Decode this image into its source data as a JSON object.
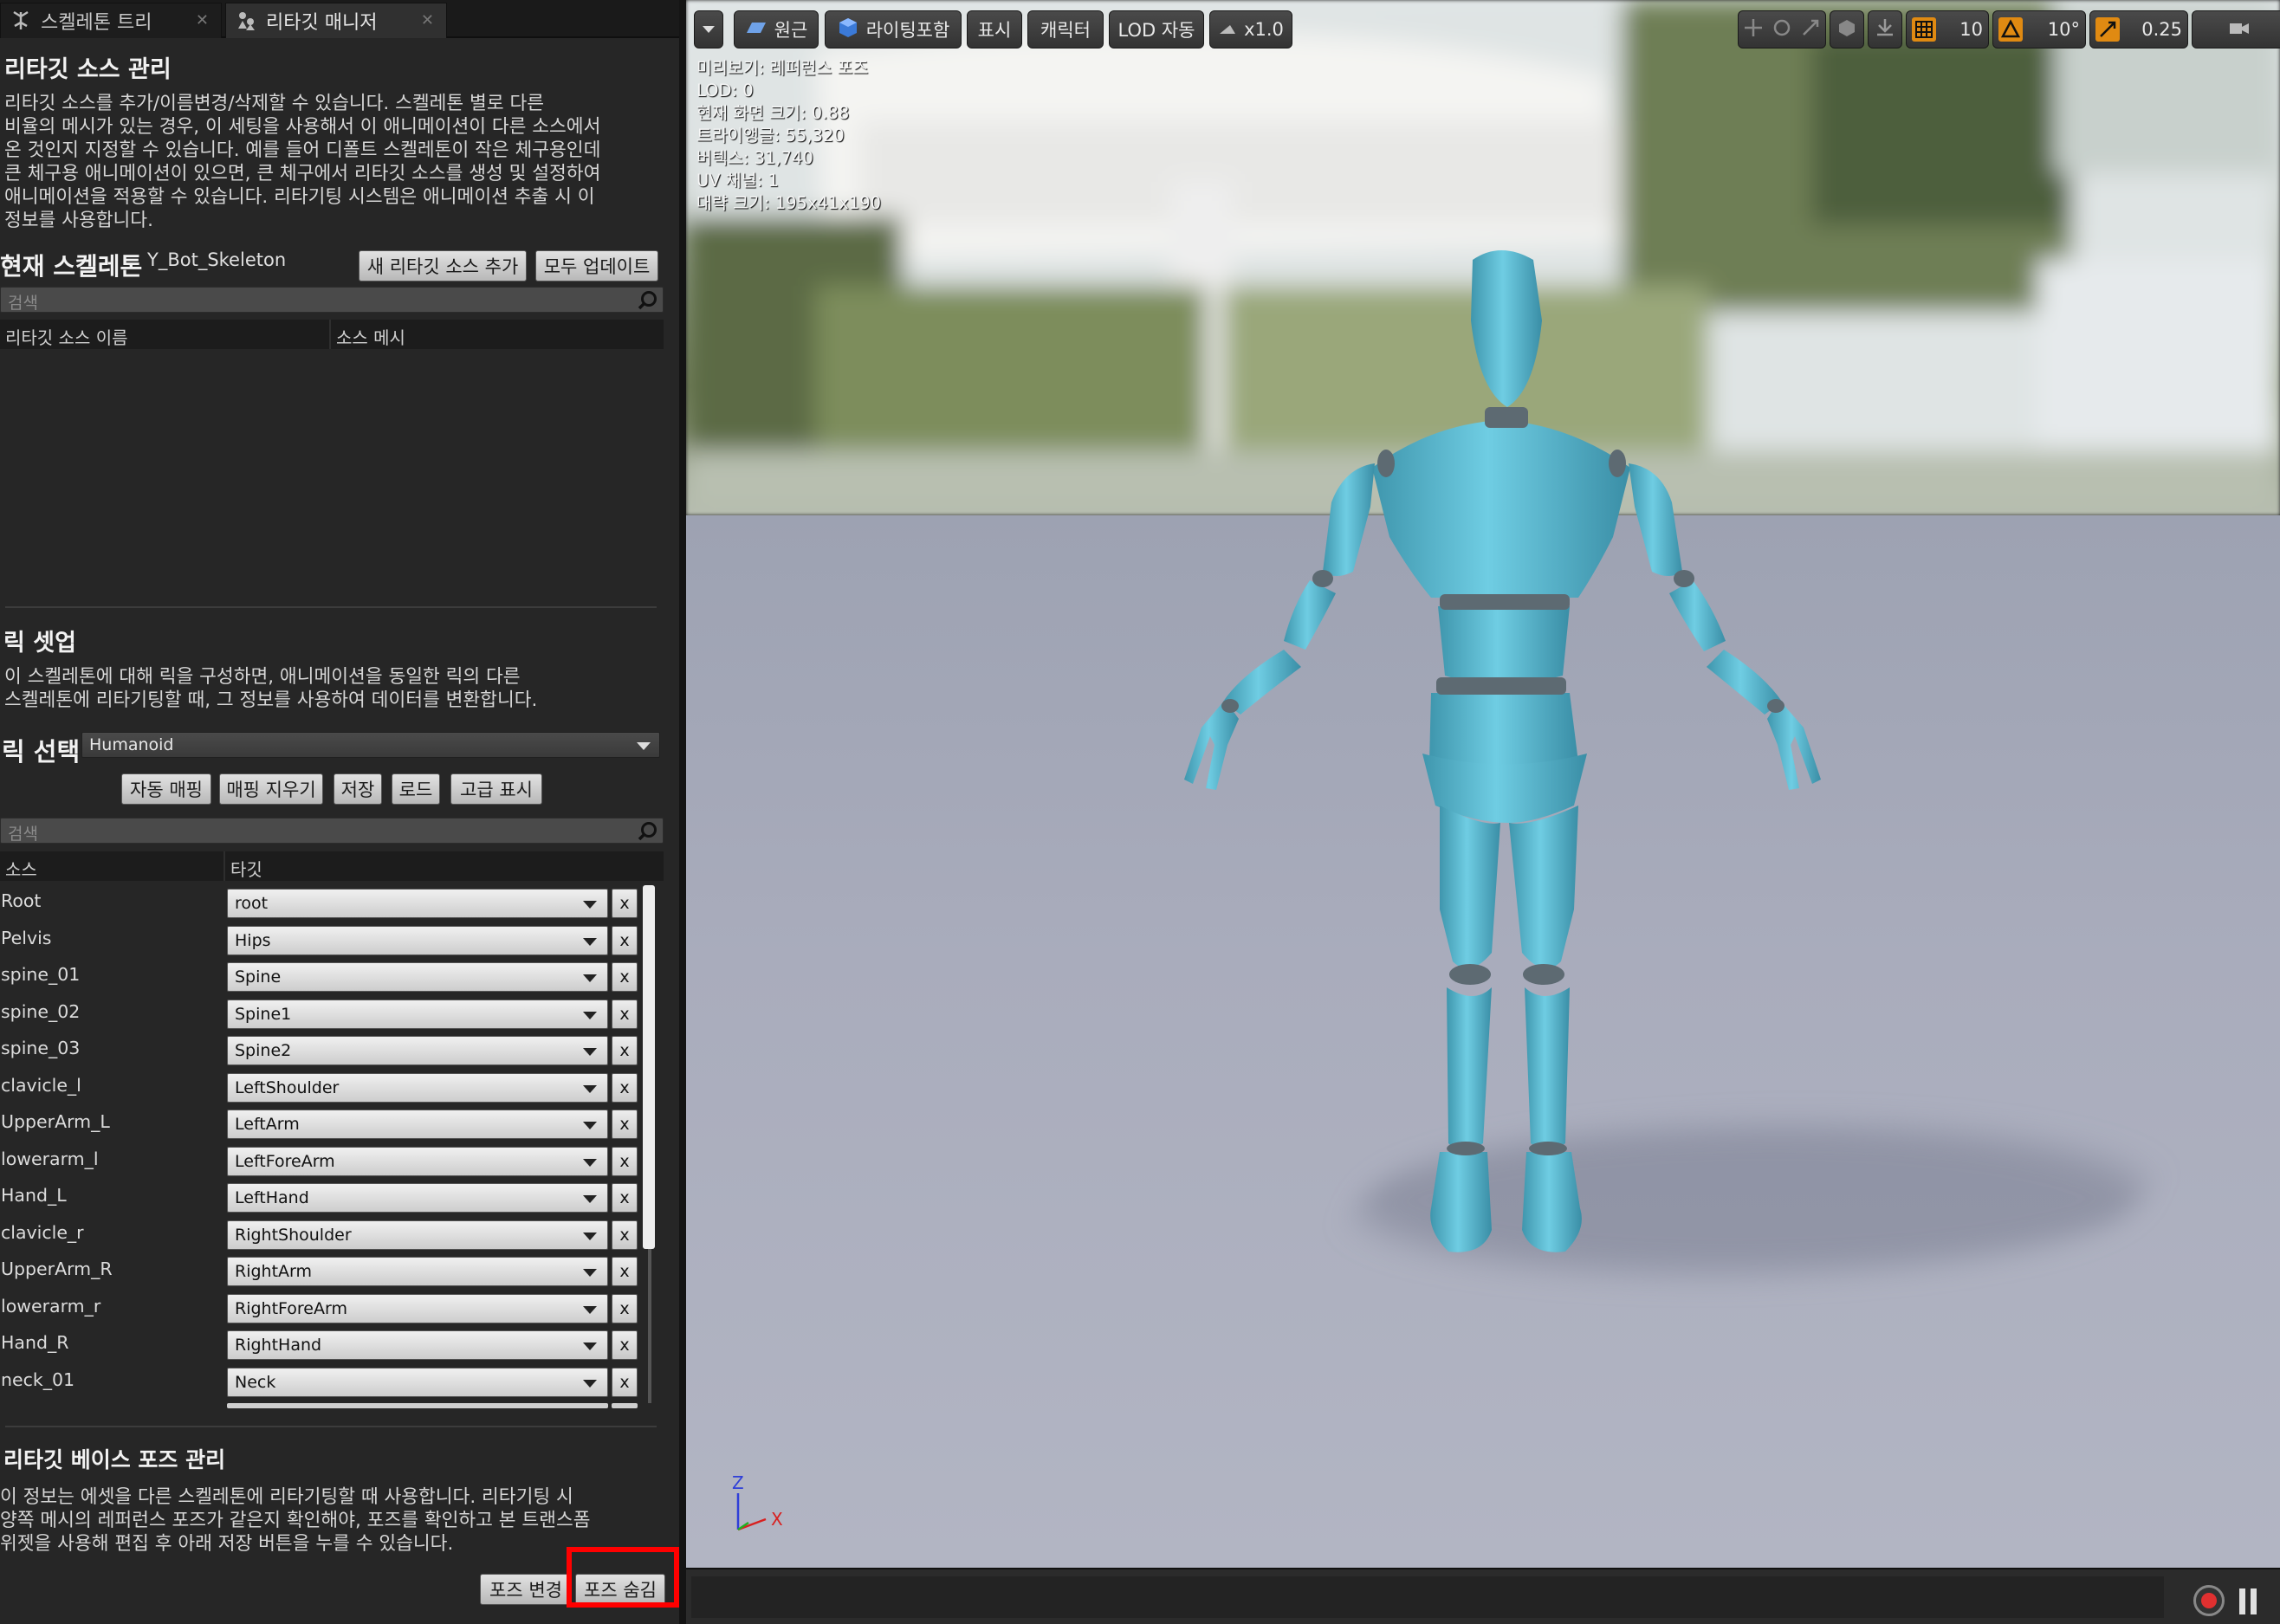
{
  "tabs": [
    {
      "label": "스켈레톤 트리",
      "icon": "skeleton-tree-icon"
    },
    {
      "label": "리타깃 매니저",
      "icon": "retarget-manager-icon"
    }
  ],
  "source": {
    "title": "리타깃 소스 관리",
    "description": [
      "리타깃 소스를 추가/이름변경/삭제할 수 있습니다. 스켈레톤 별로 다른",
      "비율의 메시가 있는 경우, 이 세팅을 사용해서 이 애니메이션이 다른 소스에서",
      "온 것인지 지정할 수 있습니다. 예를 들어 디폴트 스켈레톤이 작은 체구용인데",
      "큰 체구용 애니메이션이 있으면, 큰 체구에서 리타깃 소스를 생성 및 설정하여",
      "애니메이션을 적용할 수 있습니다. 리타기팅 시스템은 애니메이션 추출 시 이",
      "정보를 사용합니다."
    ],
    "current_skeleton_label": "현재 스켈레톤",
    "current_skeleton_value": "Y_Bot_Skeleton",
    "add_button": "새 리타깃 소스 추가",
    "update_all_button": "모두 업데이트",
    "search_placeholder": "검색",
    "col_name": "리타깃 소스 이름",
    "col_mesh": "소스 메시"
  },
  "rig": {
    "title": "릭 셋업",
    "description": [
      "이 스켈레톤에 대해 릭을 구성하면, 애니메이션을 동일한 릭의 다른",
      "스켈레톤에 리타기팅할 때, 그 정보를 사용하여 데이터를 변환합니다."
    ],
    "select_label": "릭 선택",
    "select_value": "Humanoid",
    "buttons": {
      "auto_map": "자동 매핑",
      "clear_map": "매핑 지우기",
      "save": "저장",
      "load": "로드",
      "advanced": "고급 표시"
    },
    "search_placeholder": "검색",
    "col_source": "소스",
    "col_target": "타깃",
    "mappings": [
      {
        "source": "Root",
        "target": "root"
      },
      {
        "source": "Pelvis",
        "target": "Hips"
      },
      {
        "source": "spine_01",
        "target": "Spine"
      },
      {
        "source": "spine_02",
        "target": "Spine1"
      },
      {
        "source": "spine_03",
        "target": "Spine2"
      },
      {
        "source": "clavicle_l",
        "target": "LeftShoulder"
      },
      {
        "source": "UpperArm_L",
        "target": "LeftArm"
      },
      {
        "source": "lowerarm_l",
        "target": "LeftForeArm"
      },
      {
        "source": "Hand_L",
        "target": "LeftHand"
      },
      {
        "source": "clavicle_r",
        "target": "RightShoulder"
      },
      {
        "source": "UpperArm_R",
        "target": "RightArm"
      },
      {
        "source": "lowerarm_r",
        "target": "RightForeArm"
      },
      {
        "source": "Hand_R",
        "target": "RightHand"
      },
      {
        "source": "neck_01",
        "target": "Neck"
      }
    ],
    "clear_label": "x"
  },
  "base_pose": {
    "title": "리타깃 베이스 포즈 관리",
    "description": [
      "이 정보는 에셋을 다른 스켈레톤에 리타기팅할 때 사용합니다. 리타기팅 시",
      "양쪽 메시의 레퍼런스 포즈가 같은지 확인해야, 포즈를 확인하고 본 트랜스폼",
      "위젯을 사용해 편집 후 아래 저장 버튼을 누를 수 있습니다."
    ],
    "modify_button": "포즈 변경",
    "hide_button": "포즈 숨김"
  },
  "viewport": {
    "toolbar": {
      "perspective": "원근",
      "lit": "라이팅포함",
      "show": "표시",
      "character": "캐릭터",
      "lod": "LOD 자동",
      "speed": "x1.0",
      "grid_snap": "10",
      "rot_snap": "10°",
      "scale_snap": "0.25"
    },
    "stats": [
      "미리보기: 레퍼런스 포즈",
      "LOD: 0",
      "현재 화면 크기: 0.88",
      "트라이앵글: 55,320",
      "버텍스: 31,740",
      "UV 채널: 1",
      "대략 크기: 195x41x190"
    ],
    "axis_z": "Z",
    "axis_x": "X",
    "character_color": "#5cb8cf",
    "joint_color": "#5d6a72"
  },
  "accent": "#ff0000"
}
